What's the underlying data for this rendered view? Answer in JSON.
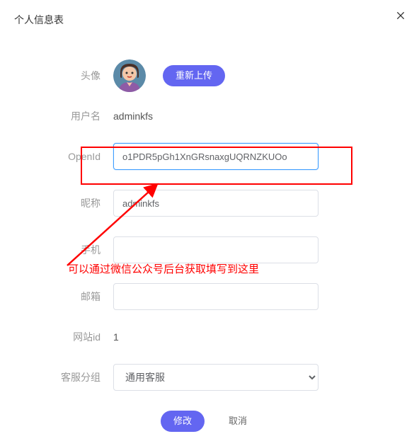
{
  "modal": {
    "title": "个人信息表"
  },
  "form": {
    "avatar_label": "头像",
    "reupload_label": "重新上传",
    "username_label": "用户名",
    "username_value": "adminkfs",
    "openid_label": "OpenId",
    "openid_value": "o1PDR5pGh1XnGRsnaxgUQRNZKUOo",
    "nickname_label": "昵称",
    "nickname_value": "adminkfs",
    "phone_label": "手机",
    "phone_value": "",
    "email_label": "邮箱",
    "email_value": "",
    "siteid_label": "网站id",
    "siteid_value": "1",
    "group_label": "客服分组",
    "group_selected": "通用客服"
  },
  "annotation": {
    "text": "可以通过微信公众号后台获取填写到这里"
  },
  "actions": {
    "submit": "修改",
    "cancel": "取消"
  }
}
